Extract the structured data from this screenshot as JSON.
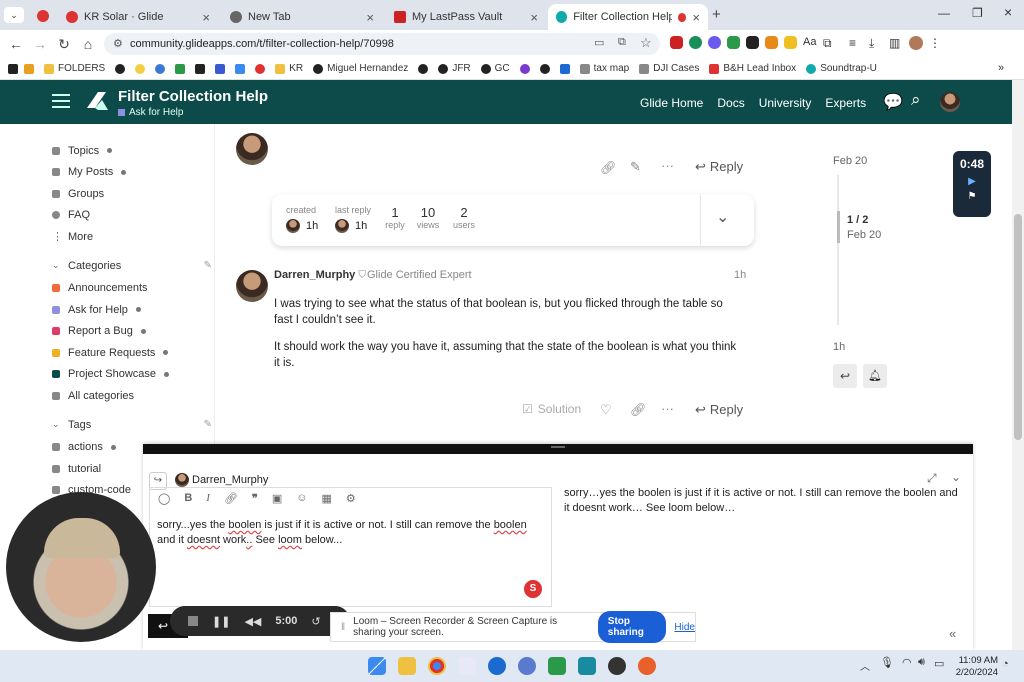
{
  "tabs": [
    {
      "label": "KR Solar · Glide",
      "color": "#d33"
    },
    {
      "label": "New Tab",
      "color": "#666"
    },
    {
      "label": "My LastPass Vault",
      "color": "#c22"
    },
    {
      "label": "Filter Collection Help - Ask",
      "color": "#1aa"
    }
  ],
  "address": {
    "url": "community.glideapps.com/t/filter-collection-help/70998"
  },
  "bookmarks": [
    "FOLDERS",
    "KR",
    "Miguel Hernandez",
    "JFR",
    "GC",
    "tax map",
    "DJI Cases",
    "B&H Lead Inbox",
    "Soundtrap-U"
  ],
  "header": {
    "title": "Filter Collection Help",
    "category": "Ask for Help",
    "nav": [
      "Glide Home",
      "Docs",
      "University",
      "Experts"
    ]
  },
  "sidebar": {
    "items": [
      "Topics",
      "My Posts",
      "Groups",
      "FAQ",
      "More"
    ],
    "categories_label": "Categories",
    "categories": [
      {
        "label": "Announcements",
        "color": "#f06a3c"
      },
      {
        "label": "Ask for Help",
        "color": "#8f8fe0"
      },
      {
        "label": "Report a Bug",
        "color": "#e03a6a"
      },
      {
        "label": "Feature Requests",
        "color": "#f0b020"
      },
      {
        "label": "Project Showcase",
        "color": "#0d4b4b"
      },
      {
        "label": "All categories",
        "color": "#888"
      }
    ],
    "tags_label": "Tags",
    "tags": [
      "actions",
      "tutorial",
      "custom-code"
    ]
  },
  "first_post": {
    "reply_label": "Reply"
  },
  "topic_map": {
    "created_label": "created",
    "created_value": "1h",
    "last_reply_label": "last reply",
    "last_reply_value": "1h",
    "replies_value": "1",
    "replies_label": "reply",
    "views_value": "10",
    "views_label": "views",
    "users_value": "2",
    "users_label": "users"
  },
  "post": {
    "author": "Darren_Murphy",
    "title": "Glide Certified Expert",
    "time": "1h",
    "p1": "I was trying to see what the status of that boolean is, but you flicked through the table so fast I couldn’t see it.",
    "p2": "It should work the way you have it, assuming that the state of the boolean is what you think it is.",
    "solution_label": "Solution",
    "reply_label": "Reply"
  },
  "timeline": {
    "top_date": "Feb 20",
    "position": "1 / 2",
    "position_date": "Feb 20",
    "bottom": "1h"
  },
  "timer": {
    "value": "0:48"
  },
  "composer": {
    "reply_to": "Darren_Murphy",
    "text_a": "sorry...yes the ",
    "text_w1": "boolen",
    "text_b": " is just if it is active or not. I still can remove the ",
    "text_w2": "boolen",
    "text_c": " and it ",
    "text_w3": "doesnt",
    "text_d": " work",
    "text_w4": "..",
    "text_e": " See ",
    "text_w5": "loom",
    "text_f": " below...",
    "preview": "sorry…yes the boolen is just if it is active or not. I still can remove the boolen and it doesnt work… See loom below…"
  },
  "loom": {
    "time": "5:00",
    "share_text": "Loom – Screen Recorder & Screen Capture is sharing your screen.",
    "stop_label": "Stop sharing",
    "hide_label": "Hide"
  },
  "clock": {
    "time": "11:09 AM",
    "date": "2/20/2024"
  }
}
